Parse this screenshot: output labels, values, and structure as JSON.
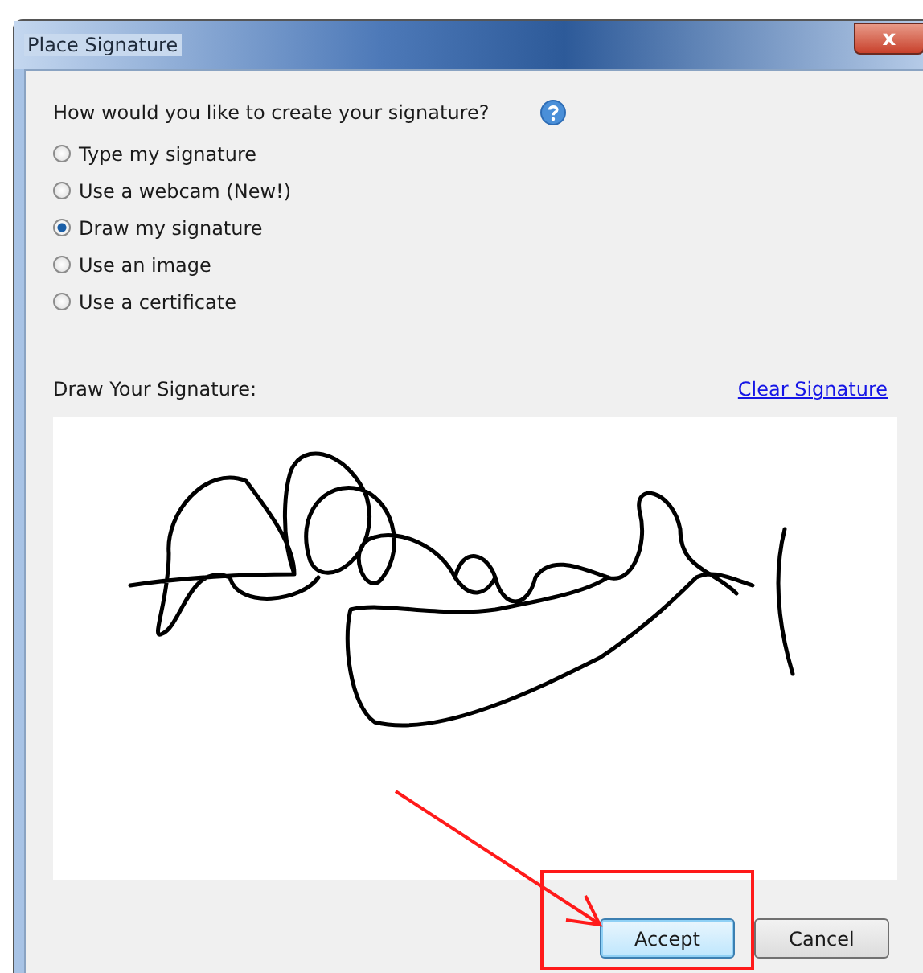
{
  "window": {
    "title": "Place Signature",
    "close_icon": "x"
  },
  "question": "How would you like to create your signature?",
  "options": [
    {
      "label": "Type my signature",
      "selected": false
    },
    {
      "label": "Use a webcam (New!)",
      "selected": false
    },
    {
      "label": "Draw my signature",
      "selected": true
    },
    {
      "label": "Use an image",
      "selected": false
    },
    {
      "label": "Use a certificate",
      "selected": false
    }
  ],
  "draw_label": "Draw Your Signature:",
  "clear_link": "Clear Signature",
  "buttons": [
    {
      "label": "Accept",
      "kind": "default"
    },
    {
      "label": "Cancel",
      "kind": "normal"
    }
  ]
}
